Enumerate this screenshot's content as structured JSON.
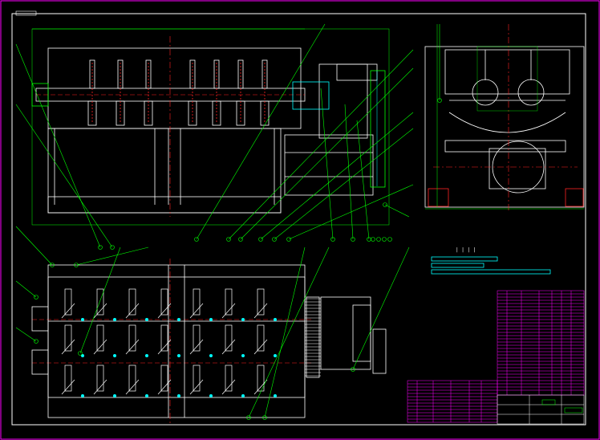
{
  "title_marks": [
    "| | | |"
  ],
  "colors": {
    "background": "#000000",
    "frame": "#ffffff",
    "outline": "#ffffff",
    "leader": "#00ff00",
    "dim": "#00ff00",
    "hidden": "#ff2222",
    "cyan": "#00ffff",
    "table": "#ff00ff"
  }
}
